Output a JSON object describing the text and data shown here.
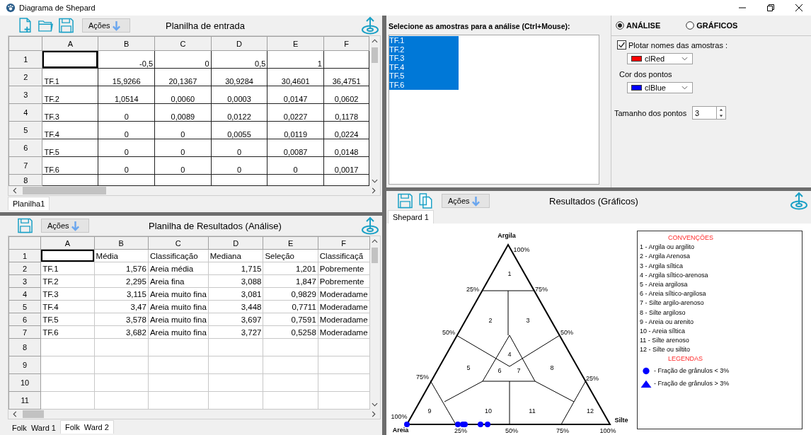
{
  "window": {
    "title": "Diagrama de Shepard"
  },
  "input_panel": {
    "toolbar": {
      "actions_label": "Ações",
      "title": "Planilha de entrada"
    },
    "sheet": {
      "kind": "input",
      "columns": [
        "A",
        "B",
        "C",
        "D",
        "E",
        "F"
      ],
      "rows": [
        {
          "label": "1",
          "cells": [
            {
              "selected": true
            },
            {
              "text": "-0,5",
              "selected": false
            },
            {
              "text": "0",
              "selected": false
            },
            {
              "text": "0,5",
              "selected": false
            },
            {
              "text": "1",
              "selected": false
            },
            {
              "selected": false
            }
          ]
        },
        {
          "label": "2",
          "cells": [
            {
              "text": "TF.1",
              "selected": false
            },
            {
              "text": "15,9266",
              "selected": false
            },
            {
              "text": "20,1367",
              "selected": false
            },
            {
              "text": "30,9284",
              "selected": false
            },
            {
              "text": "30,4601",
              "selected": false
            },
            {
              "text": "36,4751",
              "selected": false
            }
          ]
        },
        {
          "label": "3",
          "cells": [
            {
              "text": "TF.2",
              "selected": false
            },
            {
              "text": "1,0514",
              "selected": false
            },
            {
              "text": "0,0060",
              "selected": false
            },
            {
              "text": "0,0003",
              "selected": false
            },
            {
              "text": "0,0147",
              "selected": false
            },
            {
              "text": "0,0602",
              "selected": false
            }
          ]
        },
        {
          "label": "4",
          "cells": [
            {
              "text": "TF.3",
              "selected": false
            },
            {
              "text": "0",
              "selected": false
            },
            {
              "text": "0,0089",
              "selected": false
            },
            {
              "text": "0,0122",
              "selected": false
            },
            {
              "text": "0,0227",
              "selected": false
            },
            {
              "text": "0,1178",
              "selected": false
            }
          ]
        },
        {
          "label": "5",
          "cells": [
            {
              "text": "TF.4",
              "selected": false
            },
            {
              "text": "0",
              "selected": false
            },
            {
              "text": "0",
              "selected": false
            },
            {
              "text": "0,0055",
              "selected": false
            },
            {
              "text": "0,0119",
              "selected": false
            },
            {
              "text": "0,0224",
              "selected": false
            }
          ]
        },
        {
          "label": "6",
          "cells": [
            {
              "text": "TF.5",
              "selected": false
            },
            {
              "text": "0",
              "selected": false
            },
            {
              "text": "0",
              "selected": false
            },
            {
              "text": "0",
              "selected": false
            },
            {
              "text": "0,0087",
              "selected": false
            },
            {
              "text": "0,0148",
              "selected": false
            }
          ]
        },
        {
          "label": "7",
          "cells": [
            {
              "text": "TF.6",
              "selected": false
            },
            {
              "text": "0",
              "selected": false
            },
            {
              "text": "0",
              "selected": false
            },
            {
              "text": "0",
              "selected": false
            },
            {
              "text": "0",
              "selected": false
            },
            {
              "text": "0,0017",
              "selected": false
            }
          ]
        },
        {
          "label": "8",
          "cells": [
            {
              "selected": false
            },
            {
              "selected": false
            },
            {
              "selected": false
            },
            {
              "selected": false
            },
            {
              "selected": false
            },
            {
              "selected": false
            }
          ]
        }
      ]
    },
    "tabs": [
      {
        "label": "Planilha1",
        "selected": true
      }
    ]
  },
  "results_panel": {
    "toolbar": {
      "actions_label": "Ações",
      "title": "Planilha de Resultados (Análise)"
    },
    "sheet": {
      "kind": "results",
      "columns": [
        "A",
        "B",
        "C",
        "D",
        "E",
        "F"
      ],
      "rows": [
        {
          "label": "1",
          "cells": [
            {
              "selected": true
            },
            {
              "text": "Média",
              "selected": false
            },
            {
              "text": "Classificação",
              "selected": false
            },
            {
              "text": "Mediana",
              "selected": false
            },
            {
              "text": "Seleção",
              "selected": false
            },
            {
              "text": "Classificaçã",
              "selected": false
            }
          ]
        },
        {
          "label": "2",
          "cells": [
            {
              "text": "TF.1",
              "selected": false
            },
            {
              "text": "1,576",
              "selected": false
            },
            {
              "text": "Areia média",
              "selected": false
            },
            {
              "text": "1,715",
              "selected": false
            },
            {
              "text": "1,201",
              "selected": false
            },
            {
              "text": "Pobremente",
              "selected": false
            }
          ]
        },
        {
          "label": "3",
          "cells": [
            {
              "text": "TF.2",
              "selected": false
            },
            {
              "text": "2,295",
              "selected": false
            },
            {
              "text": "Areia fina",
              "selected": false
            },
            {
              "text": "3,088",
              "selected": false
            },
            {
              "text": "1,847",
              "selected": false
            },
            {
              "text": "Pobremente",
              "selected": false
            }
          ]
        },
        {
          "label": "4",
          "cells": [
            {
              "text": "TF.3",
              "selected": false
            },
            {
              "text": "3,115",
              "selected": false
            },
            {
              "text": "Areia muito fina",
              "selected": false
            },
            {
              "text": "3,081",
              "selected": false
            },
            {
              "text": "0,9829",
              "selected": false
            },
            {
              "text": "Moderadame",
              "selected": false
            }
          ]
        },
        {
          "label": "5",
          "cells": [
            {
              "text": "TF.4",
              "selected": false
            },
            {
              "text": "3,47",
              "selected": false
            },
            {
              "text": "Areia muito fina",
              "selected": false
            },
            {
              "text": "3,448",
              "selected": false
            },
            {
              "text": "0,7711",
              "selected": false
            },
            {
              "text": "Moderadame",
              "selected": false
            }
          ]
        },
        {
          "label": "6",
          "cells": [
            {
              "text": "TF.5",
              "selected": false
            },
            {
              "text": "3,578",
              "selected": false
            },
            {
              "text": "Areia muito fina",
              "selected": false
            },
            {
              "text": "3,697",
              "selected": false
            },
            {
              "text": "0,7591",
              "selected": false
            },
            {
              "text": "Moderadame",
              "selected": false
            }
          ]
        },
        {
          "label": "7",
          "cells": [
            {
              "text": "TF.6",
              "selected": false
            },
            {
              "text": "3,682",
              "selected": false
            },
            {
              "text": "Areia muito fina",
              "selected": false
            },
            {
              "text": "3,727",
              "selected": false
            },
            {
              "text": "0,5258",
              "selected": false
            },
            {
              "text": "Moderadame",
              "selected": false
            }
          ]
        },
        {
          "label": "8",
          "cells": [
            {
              "selected": false
            },
            {
              "selected": false
            },
            {
              "selected": false
            },
            {
              "selected": false
            },
            {
              "selected": false
            },
            {
              "selected": false
            }
          ]
        },
        {
          "label": "9",
          "cells": [
            {
              "selected": false
            },
            {
              "selected": false
            },
            {
              "selected": false
            },
            {
              "selected": false
            },
            {
              "selected": false
            },
            {
              "selected": false
            }
          ]
        },
        {
          "label": "10",
          "cells": [
            {
              "selected": false
            },
            {
              "selected": false
            },
            {
              "selected": false
            },
            {
              "selected": false
            },
            {
              "selected": false
            },
            {
              "selected": false
            }
          ]
        },
        {
          "label": "11",
          "cells": [
            {
              "selected": false
            },
            {
              "selected": false
            },
            {
              "selected": false
            },
            {
              "selected": false
            },
            {
              "selected": false
            },
            {
              "selected": false
            }
          ]
        }
      ]
    },
    "tabs": [
      {
        "label": "Folk  Ward 1",
        "selected": false
      },
      {
        "label": "Folk  Ward 2",
        "selected": true
      }
    ]
  },
  "samples": {
    "label": "Selecione as amostras para a análise (Ctrl+Mouse):",
    "items": [
      {
        "label": "TF.1",
        "selected": true
      },
      {
        "label": "TF.2",
        "selected": true
      },
      {
        "label": "TF.3",
        "selected": true
      },
      {
        "label": "TF.4",
        "selected": true
      },
      {
        "label": "TF.5",
        "selected": true
      },
      {
        "label": "TF.6",
        "selected": true
      }
    ]
  },
  "options": {
    "modes": [
      {
        "label": "ANÁLISE",
        "selected": true
      },
      {
        "label": "GRÁFICOS",
        "selected": false
      }
    ],
    "plot_names": {
      "label": "Plotar nomes das amostras :",
      "checked": true
    },
    "name_color": {
      "value": "clRed",
      "color": "#ff0000"
    },
    "point_color": {
      "label": "Cor dos pontos",
      "value": "clBlue",
      "color": "#0000ff"
    },
    "point_size": {
      "label": "Tamanho dos pontos",
      "value": "3"
    }
  },
  "graphics_panel": {
    "toolbar": {
      "actions_label": "Ações",
      "title": "Resultados (Gráficos)"
    },
    "tabs": [
      {
        "label": "Shepard 1",
        "selected": true
      }
    ],
    "diagram": {
      "vertices": [
        "Argila",
        "Areia",
        "Silte"
      ],
      "apex_tick": "100%",
      "left_ticks": [
        "25%",
        "50%",
        "75%",
        "100%"
      ],
      "right_ticks": [
        "75%",
        "50%",
        "25%"
      ],
      "bottom_ticks": [
        "25%",
        "50%",
        "75%",
        "100%"
      ],
      "regions": [
        "1",
        "2",
        "3",
        "4",
        "5",
        "6",
        "7",
        "8",
        "9",
        "10",
        "11",
        "12"
      ]
    },
    "legend": {
      "title": "CONVENÇÕES",
      "items": [
        "1 - Argila ou argilito",
        "2 - Argila Arenosa",
        "3 - Argila síltica",
        "4 - Argila síltico-arenosa",
        "5 - Areia argilosa",
        "6 - Areia síltico-argilosa",
        "7 - Silte argilo-arenoso",
        "8 - Silte argiloso",
        "9 - Areia ou arenito",
        "10 - Areia síltica",
        "11 - Silte arenoso",
        "12 - Silte ou siltito"
      ],
      "symbols_title": "LEGENDAS",
      "symbols": [
        {
          "kind": "circle",
          "label": "- Fração de grânulos < 3%"
        },
        {
          "kind": "triangle",
          "label": "- Fração de grânulos > 3%"
        }
      ]
    }
  }
}
